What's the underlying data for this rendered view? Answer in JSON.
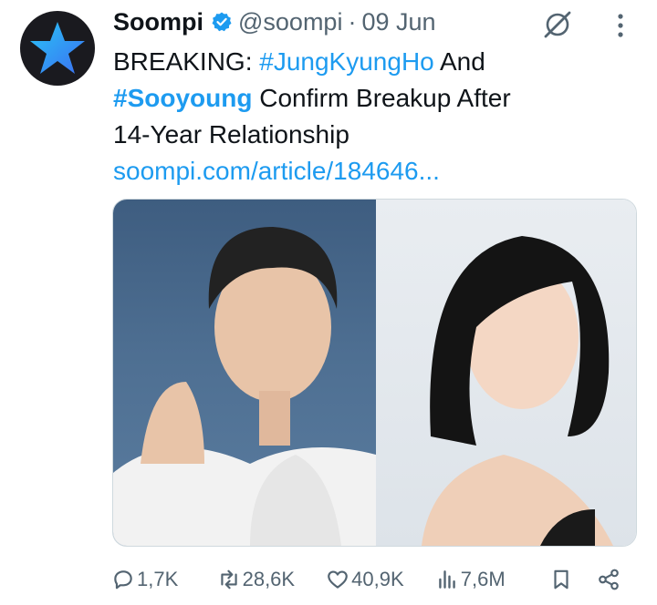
{
  "post": {
    "author_name": "Soompi",
    "handle": "@soompi",
    "separator": "·",
    "date": "09 Jun",
    "text_prefix": "BREAKING: ",
    "hashtag_1": "#JungKyungHo",
    "text_mid": " And",
    "hashtag_2": "#Sooyoung",
    "text_line2_rest": " Confirm Breakup After",
    "text_line3": "14-Year Relationship",
    "link": "soompi.com/article/184646..."
  },
  "actions": {
    "replies": "1,7K",
    "reposts": "28,6K",
    "likes": "40,9K",
    "views": "7,6M"
  },
  "colors": {
    "accent": "#1d9bf0",
    "muted": "#536471",
    "avatar_bg": "#1a1a1f"
  },
  "icons": [
    "star-logo-icon",
    "verified-badge-icon",
    "grok-icon",
    "more-icon",
    "reply-icon",
    "repost-icon",
    "like-icon",
    "views-icon",
    "bookmark-icon",
    "share-icon"
  ]
}
